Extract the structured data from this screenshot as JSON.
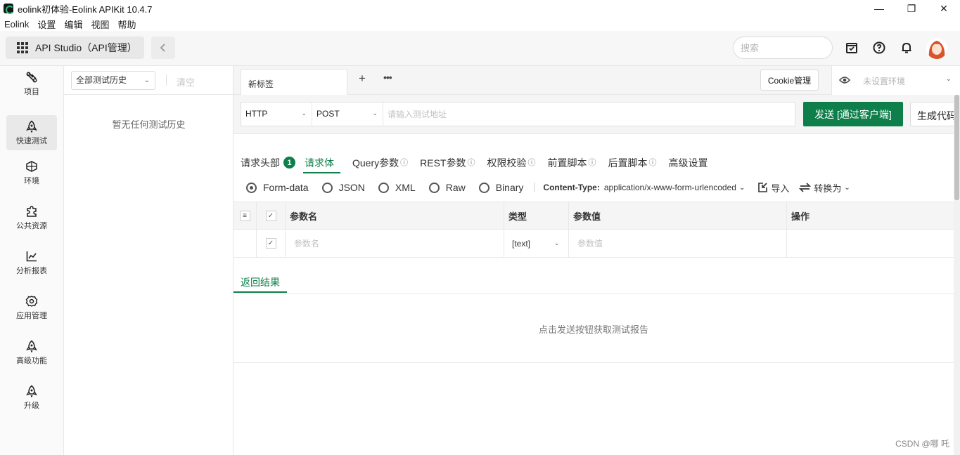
{
  "window": {
    "title": "eolink初体验-Eolink APIKit 10.4.7",
    "controls": [
      "—",
      "❐",
      "✕"
    ]
  },
  "menubar": [
    "Eolink",
    "设置",
    "编辑",
    "视图",
    "帮助"
  ],
  "topbar": {
    "studio_label": "API Studio（API管理）",
    "search_placeholder": "搜索"
  },
  "sidebar": {
    "items": [
      {
        "label": "项目",
        "icon": "project-icon"
      },
      {
        "label": "快速测试",
        "icon": "rocket-icon",
        "active": true
      },
      {
        "label": "环境",
        "icon": "environment-icon"
      },
      {
        "label": "公共资源",
        "icon": "puzzle-icon"
      },
      {
        "label": "分析报表",
        "icon": "chart-icon"
      },
      {
        "label": "应用管理",
        "icon": "gear-icon"
      },
      {
        "label": "高级功能",
        "icon": "rocket-icon"
      },
      {
        "label": "升级",
        "icon": "rocket-icon"
      }
    ]
  },
  "history": {
    "filter": "全部测试历史",
    "clear": "清空",
    "empty": "暂无任何测试历史"
  },
  "tabs": {
    "current": "新标签",
    "add": "+",
    "more": "•••",
    "cookie": "Cookie管理",
    "env": "未设置环境"
  },
  "request": {
    "protocol": "HTTP",
    "method": "POST",
    "url_placeholder": "请输入测试地址",
    "send": "发送 [通过客户端]",
    "generate": "生成代码"
  },
  "req_tabs": [
    {
      "label": "请求头部",
      "badge": "1"
    },
    {
      "label": "请求体",
      "active": true
    },
    {
      "label": "Query参数",
      "info": "ⓘ"
    },
    {
      "label": "REST参数",
      "info": "ⓘ"
    },
    {
      "label": "权限校验",
      "info": "ⓘ"
    },
    {
      "label": "前置脚本",
      "info": "ⓘ"
    },
    {
      "label": "后置脚本",
      "info": "ⓘ"
    },
    {
      "label": "高级设置"
    }
  ],
  "body": {
    "types": [
      "Form-data",
      "JSON",
      "XML",
      "Raw",
      "Binary"
    ],
    "selected": "Form-data",
    "content_type_label": "Content-Type:",
    "content_type_value": "application/x-www-form-urlencoded",
    "import": "导入",
    "convert": "转换为"
  },
  "params_table": {
    "headers": [
      "参数名",
      "类型",
      "参数值",
      "操作"
    ],
    "row": {
      "name_placeholder": "参数名",
      "type": "[text]",
      "value_placeholder": "参数值"
    }
  },
  "result": {
    "tab": "返回结果",
    "empty": "点击发送按钮获取测试报告"
  },
  "watermark": "CSDN @哪 吒",
  "colors": {
    "accent": "#0e7f4a"
  }
}
